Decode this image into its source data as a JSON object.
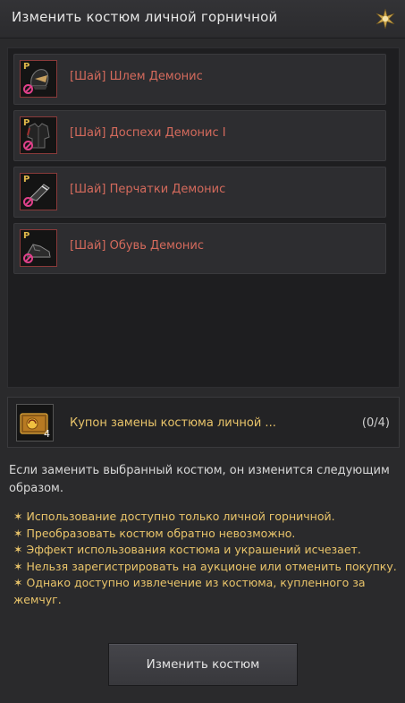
{
  "window": {
    "title": "Изменить костюм личной горничной",
    "icon": "emblem-icon"
  },
  "items": [
    {
      "label": "[Шай] Шлем Демонис",
      "badge": "P",
      "icon": "helmet-icon"
    },
    {
      "label": "[Шай] Доспехи Демонис I",
      "badge": "P",
      "icon": "armor-icon"
    },
    {
      "label": "[Шай] Перчатки Демонис",
      "badge": "P",
      "icon": "gloves-icon"
    },
    {
      "label": "[Шай] Обувь Демонис",
      "badge": "P",
      "icon": "shoes-icon"
    }
  ],
  "coupon": {
    "label": "Купон замены костюма личной ...",
    "count": "4",
    "progress": "(0/4)",
    "icon": "coupon-ticket-icon"
  },
  "description": "Если заменить выбранный костюм, он изменится следующим образом.",
  "notes": [
    "Использование доступно только личной горничной.",
    "Преобразовать костюм обратно невозможно.",
    "Эффект использования костюма и украшений исчезает.",
    "Нельзя зарегистрировать на аукционе или отменить покупку.",
    "Однако доступно извлечение из костюма, купленного за жемчуг."
  ],
  "note_bullet": "✶",
  "button": {
    "label": "Изменить костюм"
  },
  "colors": {
    "background": "#2a2a2c",
    "item_name": "#d46a5c",
    "note_text": "#e9c46a",
    "ban_icon": "#e0408a"
  }
}
